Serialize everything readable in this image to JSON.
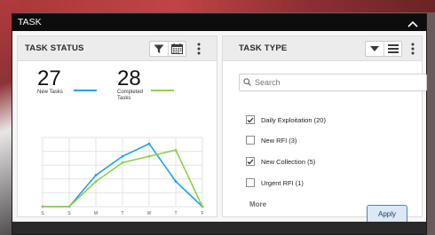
{
  "window": {
    "title": "TASK"
  },
  "task_status": {
    "title": "TASK STATUS",
    "new_tasks": {
      "count": "27",
      "label": "New Tasks",
      "color": "#1aa3e0"
    },
    "completed_tasks": {
      "count": "28",
      "label_line1": "Completed",
      "label_line2": "Tasks",
      "color": "#8ecf4a"
    },
    "icons": [
      "filter-icon",
      "calendar-icon",
      "more-vert-icon"
    ]
  },
  "task_type": {
    "title": "TASK TYPE",
    "icons": [
      "dropdown-caret-icon",
      "list-icon",
      "more-vert-icon"
    ],
    "search": {
      "placeholder": "Search",
      "value": ""
    },
    "items": [
      {
        "label": "Daily Exploitation (20)",
        "checked": true
      },
      {
        "label": "New RFI (3)",
        "checked": false
      },
      {
        "label": "New Collection (5)",
        "checked": true
      },
      {
        "label": "Urgent RFI (1)",
        "checked": false
      }
    ],
    "more_label": "More",
    "apply_label": "Apply"
  },
  "chart_data": {
    "type": "line",
    "categories": [
      "S",
      "S",
      "M",
      "T",
      "W",
      "T",
      "F"
    ],
    "series": [
      {
        "name": "New Tasks",
        "color": "#1aa3e0",
        "values": [
          0,
          0,
          10,
          16,
          20,
          8,
          0
        ]
      },
      {
        "name": "Completed Tasks",
        "color": "#8ecf4a",
        "values": [
          0,
          0,
          8,
          14,
          16,
          18,
          0
        ]
      }
    ],
    "ylim": [
      0,
      22
    ],
    "grid": true
  }
}
